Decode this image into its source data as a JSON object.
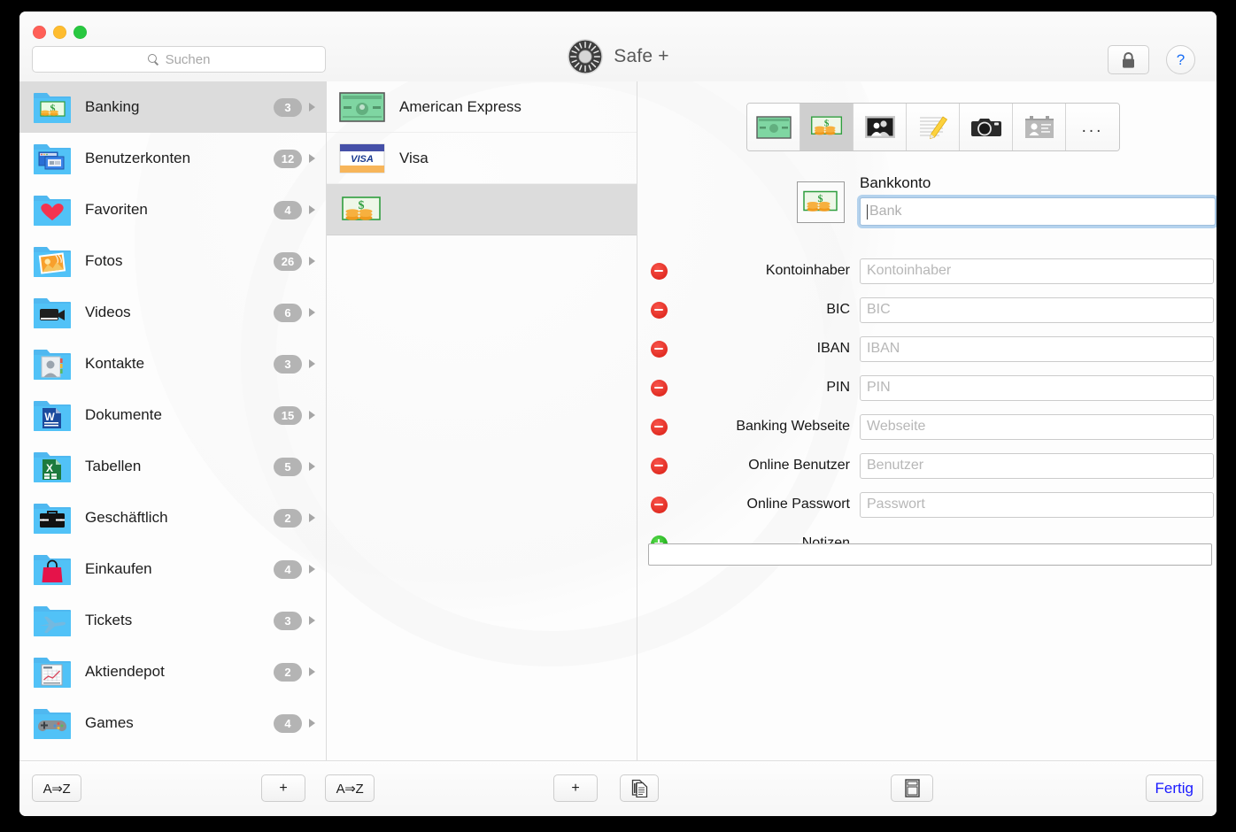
{
  "window": {
    "title": "Safe +",
    "logo_icon": "vault-dial-icon",
    "traffic_lights": [
      "close",
      "minimize",
      "maximize"
    ],
    "colors": {
      "close": "#ff5f57",
      "minimize": "#febc2e",
      "maximize": "#28c840",
      "accent_blue": "#1a6ef5",
      "done_blue": "#1a1aff",
      "selection_gray": "#dcdcdc",
      "badge_gray": "#b4b4b4",
      "remove_red": "#e02a20",
      "add_green": "#16a712",
      "focus_ring": "#7ab0e2"
    }
  },
  "toolbar": {
    "search": {
      "placeholder": "Suchen",
      "value": "",
      "icon": "search-icon"
    },
    "lock_button": {
      "icon": "lock-icon",
      "label": ""
    },
    "help_button": {
      "icon": "question-mark-icon",
      "label": "?"
    }
  },
  "sidebar": {
    "items": [
      {
        "label": "Banking",
        "count": "3",
        "icon": "folder-money-icon",
        "selected": true
      },
      {
        "label": "Benutzerkonten",
        "count": "12",
        "icon": "folder-windows-icon",
        "selected": false
      },
      {
        "label": "Favoriten",
        "count": "4",
        "icon": "folder-heart-icon",
        "selected": false
      },
      {
        "label": "Fotos",
        "count": "26",
        "icon": "folder-photo-icon",
        "selected": false
      },
      {
        "label": "Videos",
        "count": "6",
        "icon": "folder-video-icon",
        "selected": false
      },
      {
        "label": "Kontakte",
        "count": "3",
        "icon": "folder-contact-icon",
        "selected": false
      },
      {
        "label": "Dokumente",
        "count": "15",
        "icon": "folder-word-icon",
        "selected": false
      },
      {
        "label": "Tabellen",
        "count": "5",
        "icon": "folder-excel-icon",
        "selected": false
      },
      {
        "label": "Geschäftlich",
        "count": "2",
        "icon": "folder-briefcase-icon",
        "selected": false
      },
      {
        "label": "Einkaufen",
        "count": "4",
        "icon": "folder-shopping-icon",
        "selected": false
      },
      {
        "label": "Tickets",
        "count": "3",
        "icon": "folder-airplane-icon",
        "selected": false
      },
      {
        "label": "Aktiendepot",
        "count": "2",
        "icon": "folder-chart-icon",
        "selected": false
      },
      {
        "label": "Games",
        "count": "4",
        "icon": "folder-gamepad-icon",
        "selected": false
      }
    ]
  },
  "middle_column": {
    "items": [
      {
        "label": "American Express",
        "icon": "amex-card-icon",
        "selected": false
      },
      {
        "label": "Visa",
        "icon": "visa-card-icon",
        "selected": false
      },
      {
        "label": "",
        "icon": "money-bill-icon",
        "selected": true
      }
    ]
  },
  "detail": {
    "type_segments": [
      {
        "icon": "credit-card-icon",
        "active": false,
        "label": ""
      },
      {
        "icon": "money-bill-icon",
        "active": true,
        "label": ""
      },
      {
        "icon": "people-photo-icon",
        "active": false,
        "label": ""
      },
      {
        "icon": "note-pencil-icon",
        "active": false,
        "label": ""
      },
      {
        "icon": "camera-icon",
        "active": false,
        "label": ""
      },
      {
        "icon": "contact-card-icon",
        "active": false,
        "label": ""
      },
      {
        "icon": "ellipsis-icon",
        "active": false,
        "label": "..."
      }
    ],
    "record": {
      "type_icon": "money-bill-icon",
      "type_title": "Bankkonto",
      "name_field": {
        "placeholder": "Bank",
        "value": "",
        "focused": true
      }
    },
    "fields": [
      {
        "label": "Kontoinhaber",
        "placeholder": "Kontoinhaber",
        "value": "",
        "action": "remove"
      },
      {
        "label": "BIC",
        "placeholder": "BIC",
        "value": "",
        "action": "remove"
      },
      {
        "label": "IBAN",
        "placeholder": "IBAN",
        "value": "",
        "action": "remove"
      },
      {
        "label": "PIN",
        "placeholder": "PIN",
        "value": "",
        "action": "remove"
      },
      {
        "label": "Banking Webseite",
        "placeholder": "Webseite",
        "value": "",
        "action": "remove"
      },
      {
        "label": "Online Benutzer",
        "placeholder": "Benutzer",
        "value": "",
        "action": "remove"
      },
      {
        "label": "Online Passwort",
        "placeholder": "Passwort",
        "value": "",
        "action": "remove"
      }
    ],
    "notes": {
      "label": "Notizen",
      "value": "",
      "action": "add"
    }
  },
  "bottom_bar": {
    "sort_sidebar": {
      "label": "A⇒Z",
      "icon": "sort-az-icon"
    },
    "add_category": {
      "label": "+",
      "icon": "plus-icon"
    },
    "sort_entries": {
      "label": "A⇒Z",
      "icon": "sort-az-icon"
    },
    "add_entry": {
      "label": "+",
      "icon": "plus-icon"
    },
    "duplicate": {
      "label": "",
      "icon": "duplicate-document-icon"
    },
    "template": {
      "label": "",
      "icon": "template-layout-icon"
    },
    "done": {
      "label": "Fertig"
    }
  }
}
